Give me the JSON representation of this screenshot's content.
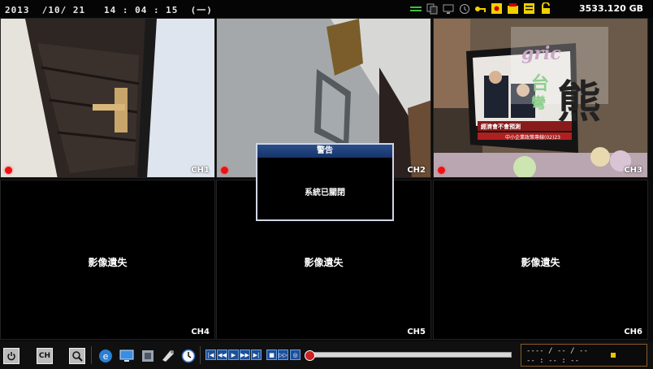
{
  "status_bar": {
    "datetime": "2013  /10/ 21   14 : 04 : 15  (一)",
    "disk_free": "3533.120 GB",
    "icons": [
      "network-icon",
      "copy-icon",
      "display-icon",
      "clock-icon",
      "key-icon",
      "alarm-icon",
      "record-icon",
      "schedule-icon",
      "lock-icon"
    ]
  },
  "channels": [
    {
      "label": "CH1",
      "recording": true,
      "lost_text": ""
    },
    {
      "label": "CH2",
      "recording": true,
      "lost_text": ""
    },
    {
      "label": "CH3",
      "recording": true,
      "lost_text": ""
    },
    {
      "label": "CH4",
      "recording": false,
      "lost_text": "影像遺失"
    },
    {
      "label": "CH5",
      "recording": false,
      "lost_text": "影像遺失"
    },
    {
      "label": "CH6",
      "recording": false,
      "lost_text": "影像遺失"
    }
  ],
  "watermark": {
    "brand": "gric",
    "line2": "台",
    "line3": "彎",
    "char": "熊"
  },
  "tv_overlay": {
    "caption": "經濟會不會預測",
    "ticker": "中小企業政策專線(02)23"
  },
  "dialog": {
    "title": "警告",
    "message": "系統已關閉"
  },
  "toolbar": {
    "ch_label": "CH",
    "playback_buttons": [
      "first",
      "rewind",
      "play",
      "play-fast",
      "last",
      "stop",
      "next-frame",
      "speed"
    ]
  },
  "playback": {
    "position": 0.0
  },
  "time_box": {
    "date": "---- / -- / --",
    "time": "-- : -- : --"
  }
}
